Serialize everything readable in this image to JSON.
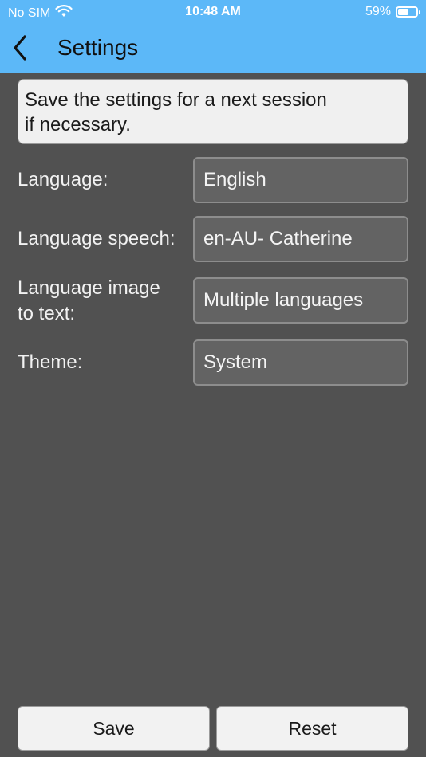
{
  "status_bar": {
    "carrier": "No SIM",
    "time": "10:48 AM",
    "battery_percent": "59%",
    "battery_level": 0.59,
    "wifi_icon": "wifi-icon"
  },
  "nav": {
    "title": "Settings",
    "back_icon": "chevron-left-icon"
  },
  "info": {
    "message_line1": "Save the settings for a next session",
    "message_line2": "if necessary."
  },
  "settings": {
    "language": {
      "label": "Language:",
      "value": "English"
    },
    "language_speech": {
      "label": "Language speech:",
      "value": "en-AU- Catherine"
    },
    "language_image_to_text": {
      "label_line1": "Language image",
      "label_line2": "to text:",
      "value": "Multiple languages"
    },
    "theme": {
      "label": "Theme:",
      "value": "System"
    }
  },
  "actions": {
    "save_label": "Save",
    "reset_label": "Reset"
  },
  "colors": {
    "header_bg": "#5cb8f8",
    "page_bg": "#515151",
    "field_bg": "#636363",
    "button_bg": "#f2f2f2"
  }
}
